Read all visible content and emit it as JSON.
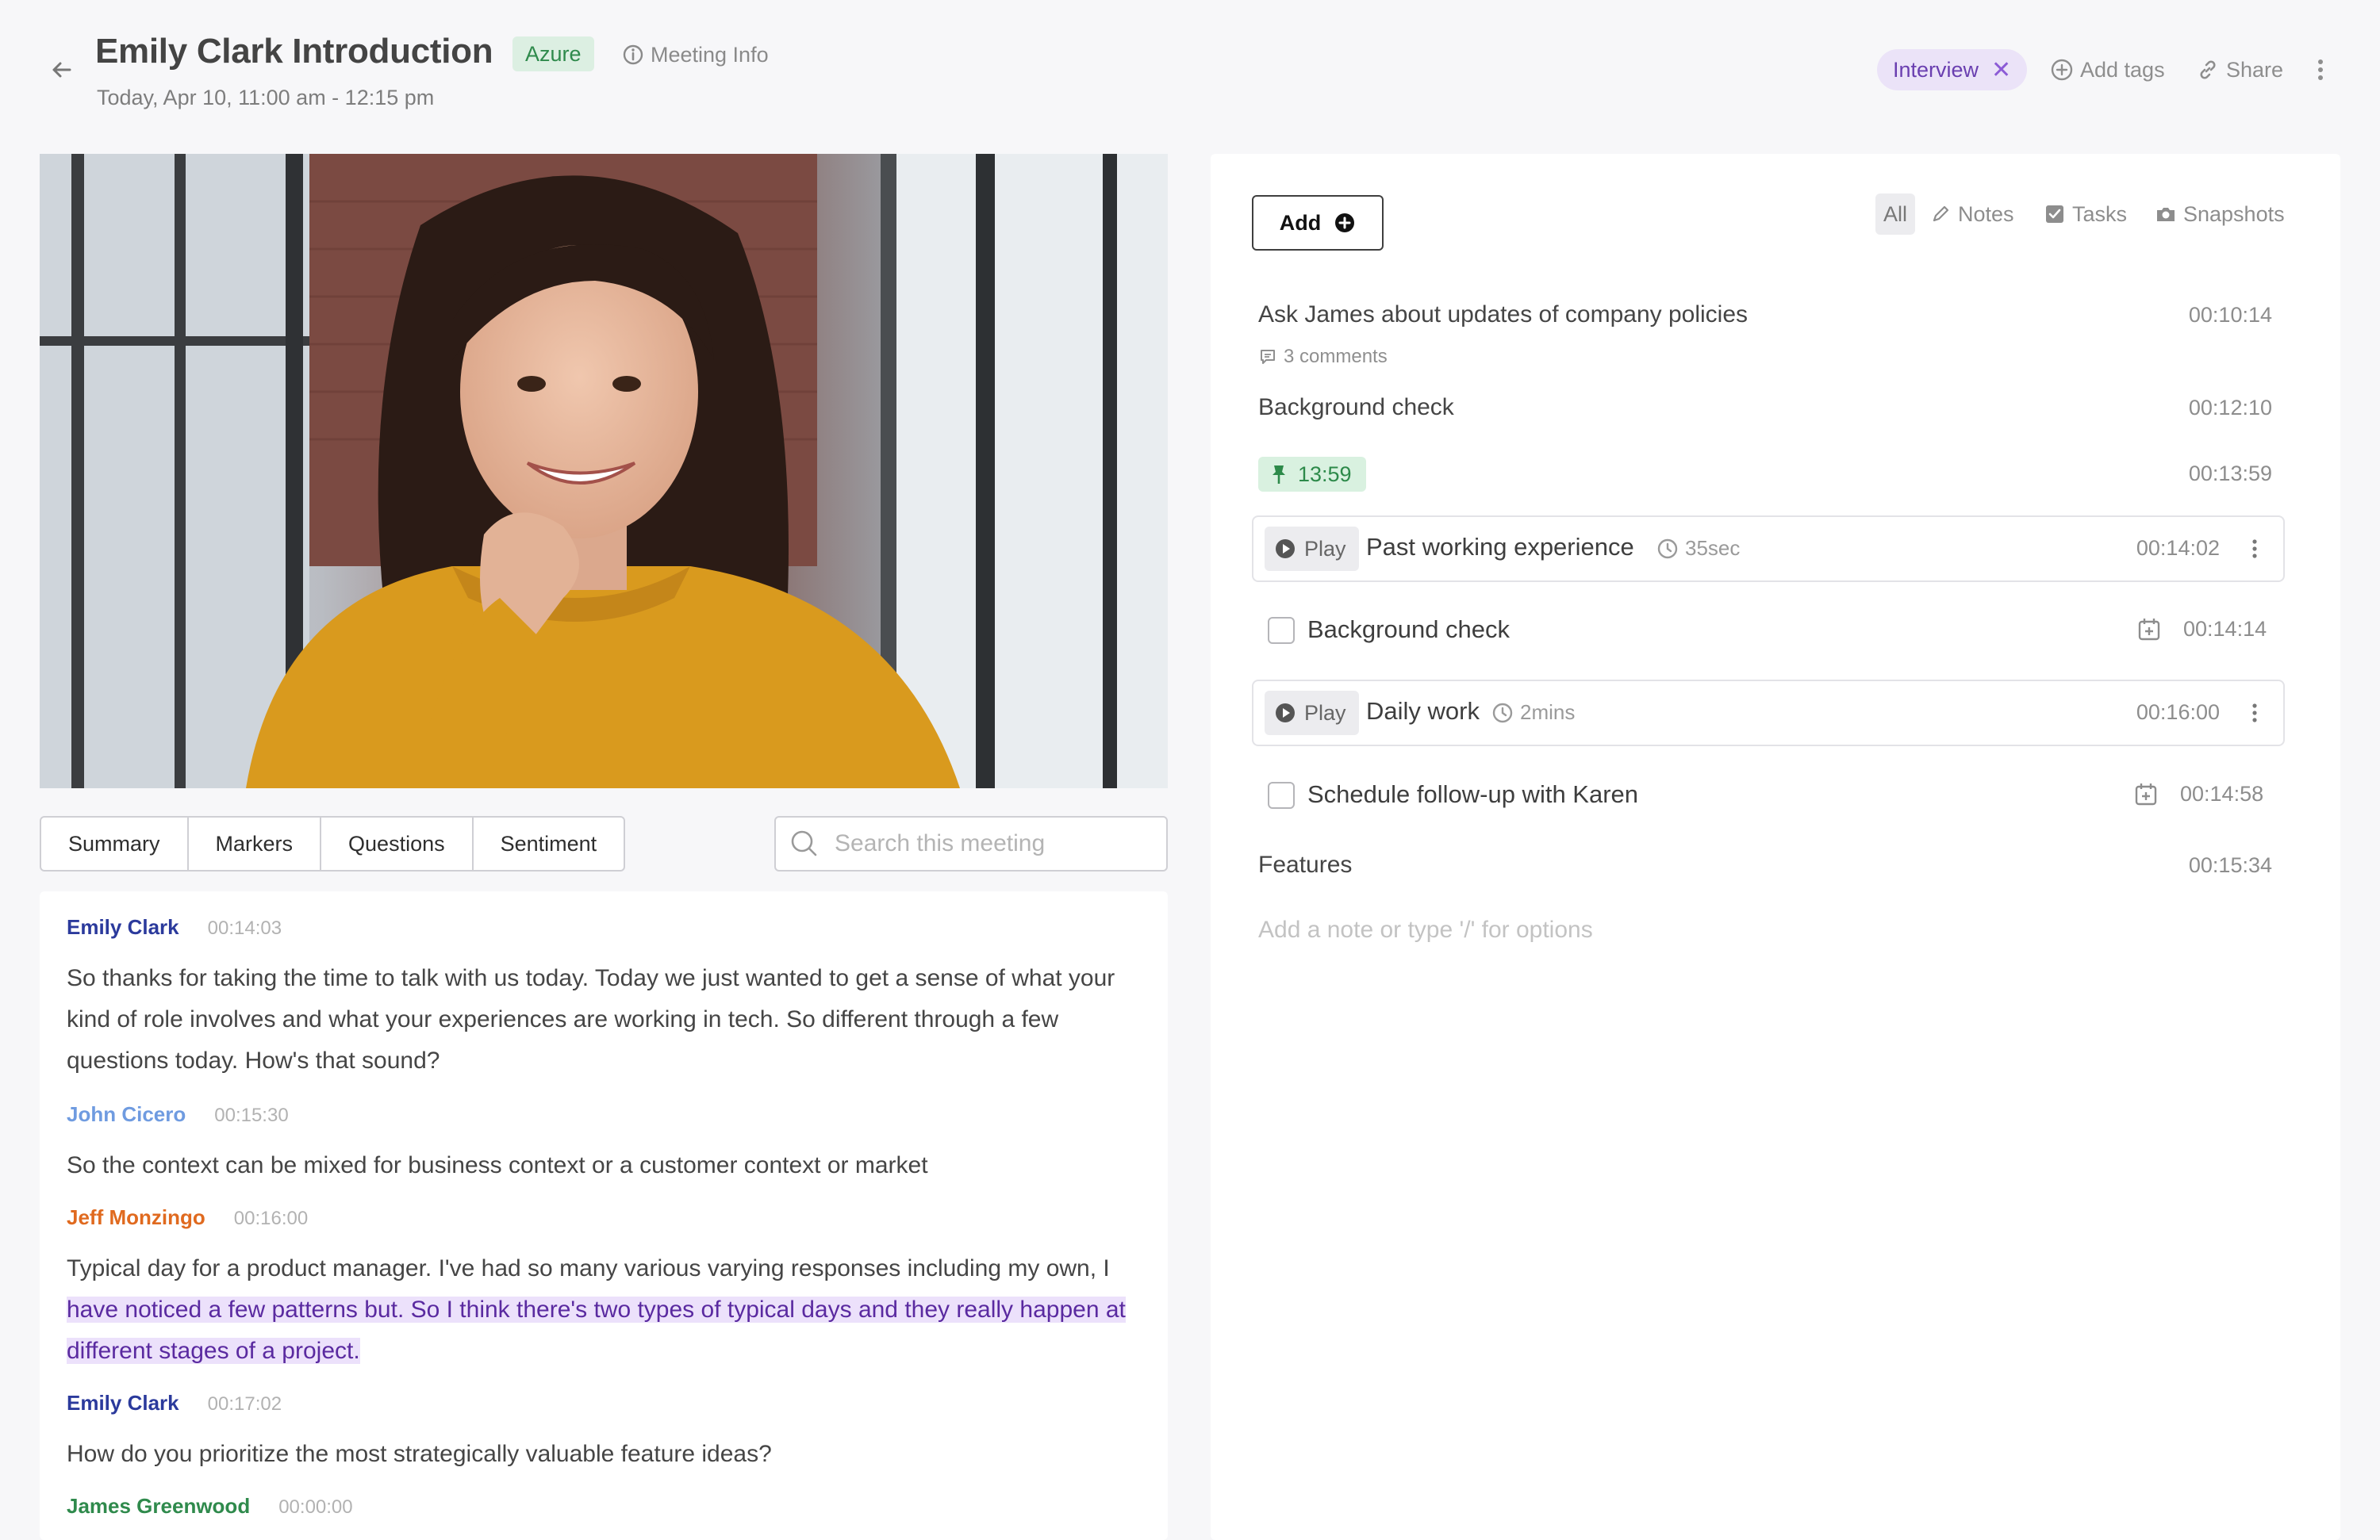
{
  "header": {
    "title": "Emily Clark Introduction",
    "badge": "Azure",
    "meeting_info_label": "Meeting Info",
    "subtitle": "Today, Apr 10, 11:00 am - 12:15 pm",
    "tag": "Interview",
    "add_tags_label": "Add tags",
    "share_label": "Share"
  },
  "tabs": [
    "Summary",
    "Markers",
    "Questions",
    "Sentiment"
  ],
  "search": {
    "placeholder": "Search this meeting"
  },
  "transcript": [
    {
      "speaker": "Emily Clark",
      "time": "00:14:03",
      "color": "#2b3a9c",
      "text": "So thanks for taking the time to talk with us today. Today we just wanted to get a sense of what your kind of role involves and what your experiences are working in tech. So different through a few questions today. How's that sound?"
    },
    {
      "speaker": "John Cicero",
      "time": "00:15:30",
      "color": "#6f9be0",
      "text": "So the context can be mixed for business context or a customer context or market"
    },
    {
      "speaker": "Jeff Monzingo",
      "time": "00:16:00",
      "color": "#e06a1f",
      "text_before": "Typical day for a product manager. I've had so many various varying responses including my own, I ",
      "text_highlight": "have noticed a few patterns but. So I think there's two types of typical days and they really happen at different stages of a project."
    },
    {
      "speaker": "Emily Clark",
      "time": "00:17:02",
      "color": "#2b3a9c",
      "text": "How do you prioritize the most strategically valuable feature ideas?"
    },
    {
      "speaker": "James Greenwood",
      "time": "00:00:00",
      "color": "#2f8a4c",
      "text": ""
    }
  ],
  "panel": {
    "add_label": "Add",
    "filters": {
      "all": "All",
      "notes": "Notes",
      "tasks": "Tasks",
      "snapshots": "Snapshots"
    },
    "items": [
      {
        "title": "Ask James about updates of company policies",
        "time": "00:10:14",
        "comments": "3 comments"
      },
      {
        "title": "Background check",
        "time": "00:12:10"
      },
      {
        "pin": "13:59",
        "time": "00:13:59"
      },
      {
        "play_label": "Play",
        "title": "Past working experience",
        "duration": "35sec",
        "time": "00:14:02"
      },
      {
        "title": "Background check",
        "time": "00:14:14",
        "checked": false
      },
      {
        "play_label": "Play",
        "title": "Daily work",
        "duration": "2mins",
        "time": "00:16:00"
      },
      {
        "title": "Schedule follow-up with Karen",
        "time": "00:14:58",
        "checked": false
      },
      {
        "title": "Features",
        "time": "00:15:34"
      }
    ],
    "note_placeholder": "Add a note or type '/' for options"
  },
  "colors": {
    "accent_purple": "#6a3fb0",
    "accent_green": "#2f8a4c",
    "highlight": "#ece1fb"
  }
}
